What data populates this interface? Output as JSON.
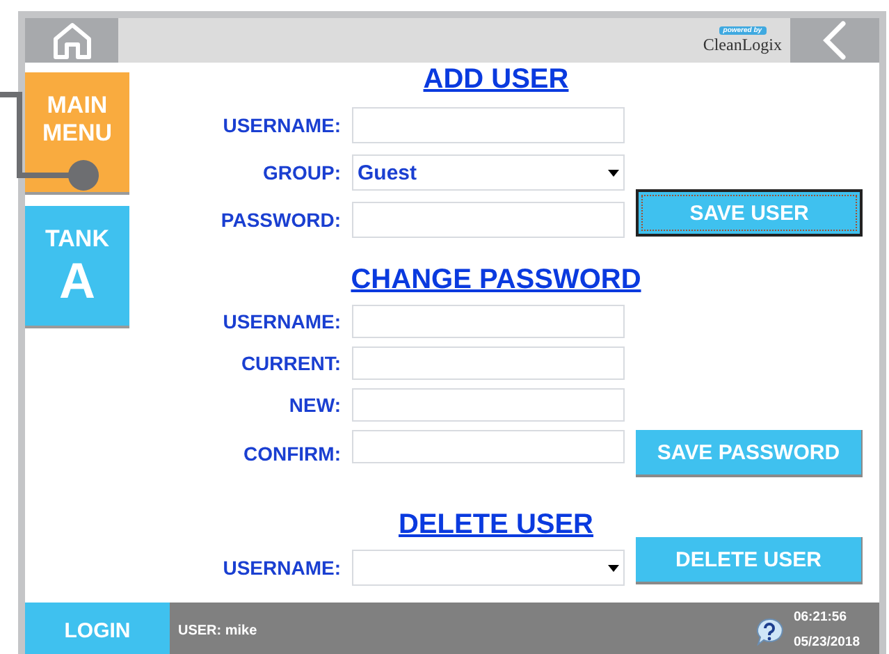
{
  "topbar": {
    "logo_tag": "powered by",
    "logo": "CleanLogix"
  },
  "sidebar": [
    {
      "kind": "menu",
      "lines": [
        "MAIN",
        "MENU"
      ],
      "color": "#f9ab3f"
    },
    {
      "kind": "tank",
      "lines": [
        "TANK",
        "A"
      ],
      "color": "#3fc1ef"
    }
  ],
  "sections": [
    {
      "title": "ADD USER",
      "fields": [
        {
          "kind": "text",
          "label": "USERNAME:"
        },
        {
          "kind": "select",
          "label": "GROUP:",
          "value": "Guest"
        },
        {
          "kind": "text",
          "label": "PASSWORD:"
        }
      ],
      "button": {
        "label": "SAVE USER",
        "focused": true
      }
    },
    {
      "title": "CHANGE PASSWORD",
      "fields": [
        {
          "kind": "text",
          "label": "USERNAME:"
        },
        {
          "kind": "text",
          "label": "CURRENT:"
        },
        {
          "kind": "text",
          "label": "NEW:"
        },
        {
          "kind": "text",
          "label": "CONFIRM:"
        }
      ],
      "button": {
        "label": "SAVE PASSWORD",
        "focused": false
      }
    },
    {
      "title": "DELETE USER",
      "fields": [
        {
          "kind": "select",
          "label": "USERNAME:"
        }
      ],
      "button": {
        "label": "DELETE USER",
        "focused": false
      }
    }
  ],
  "footer": {
    "login": "LOGIN",
    "user": "USER: mike",
    "time": "06:21:56",
    "date": "05/23/2018"
  }
}
